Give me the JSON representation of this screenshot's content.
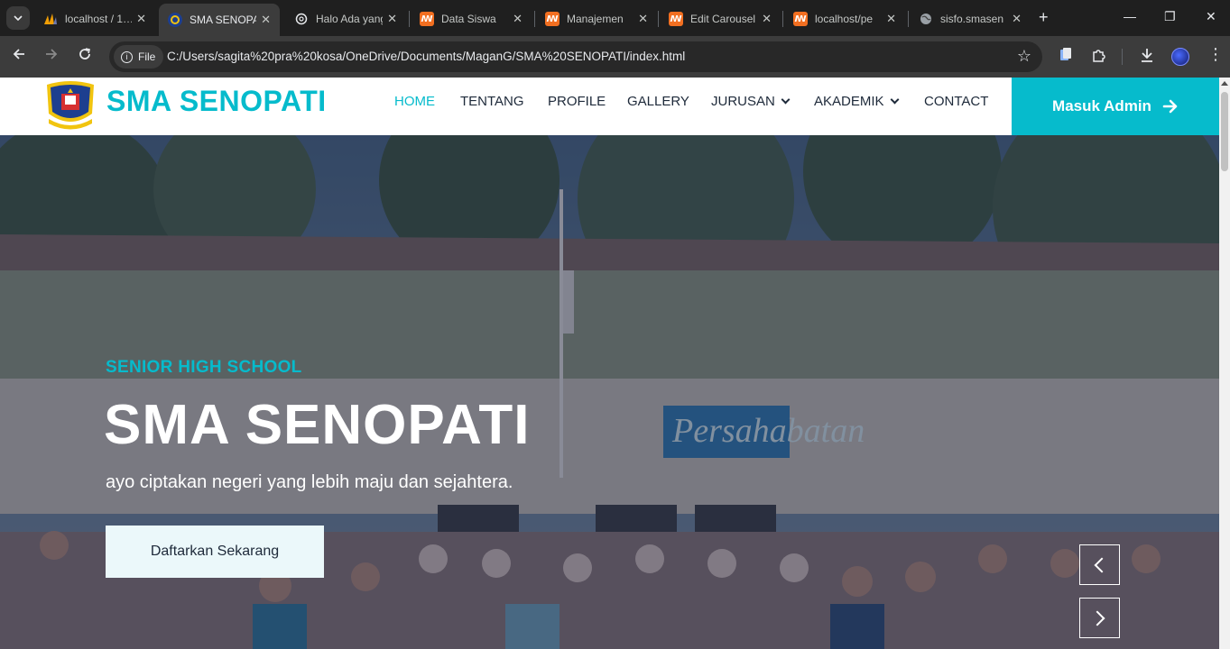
{
  "browser": {
    "tabs": [
      {
        "title": "localhost / 1…",
        "favicon": "phpmyadmin-icon",
        "active": false
      },
      {
        "title": "SMA SENOPATI",
        "favicon": "school-logo-icon",
        "active": true
      },
      {
        "title": "Halo Ada yang",
        "favicon": "chatgpt-icon",
        "active": false
      },
      {
        "title": "Data Siswa",
        "favicon": "xampp-icon",
        "active": false
      },
      {
        "title": "Manajemen",
        "favicon": "xampp-icon",
        "active": false
      },
      {
        "title": "Edit Carousel",
        "favicon": "xampp-icon",
        "active": false
      },
      {
        "title": "localhost/pe",
        "favicon": "xampp-icon",
        "active": false
      },
      {
        "title": "sisfo.smasen",
        "favicon": "globe-icon",
        "active": false
      }
    ],
    "address": {
      "scheme_chip": "File",
      "url": "C:/Users/sagita%20pra%20kosa/OneDrive/Documents/MaganG/SMA%20SENOPATI/index.html"
    }
  },
  "site": {
    "brand": "SMA SENOPATI",
    "nav": {
      "home": "HOME",
      "tentang": "TENTANG",
      "profile": "PROFILE",
      "gallery": "GALLERY",
      "jurusan": "JURUSAN",
      "akademik": "AKADEMIK",
      "contact": "CONTACT"
    },
    "admin_button": "Masuk Admin",
    "accent_color": "#06bbcc"
  },
  "hero": {
    "eyebrow": "SENIOR HIGH SCHOOL",
    "title": "SMA SENOPATI",
    "tagline": "ayo ciptakan negeri yang lebih maju dan sejahtera.",
    "cta": "Daftarkan Sekarang",
    "banner_text": "Persahabatan"
  }
}
